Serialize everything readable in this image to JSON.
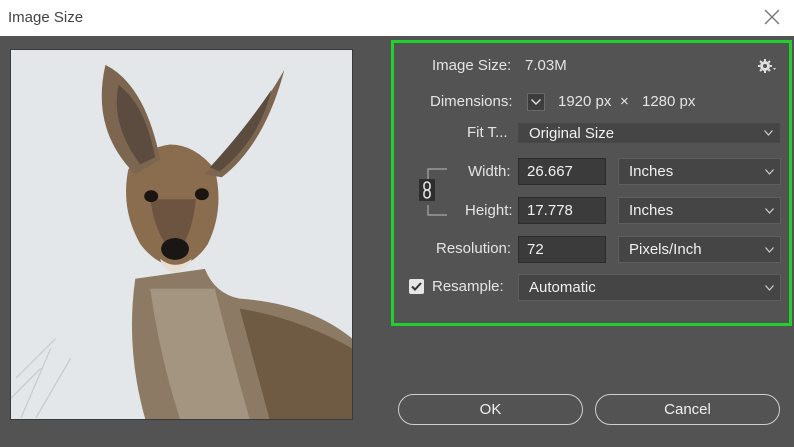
{
  "window": {
    "title": "Image Size"
  },
  "info": {
    "image_size_label": "Image Size:",
    "image_size_value": "7.03M",
    "dimensions_label": "Dimensions:",
    "dim_width": "1920 px",
    "dim_times": "×",
    "dim_height": "1280 px"
  },
  "fit_to": {
    "label": "Fit T...",
    "value": "Original Size"
  },
  "width": {
    "label": "Width:",
    "value": "26.667",
    "unit": "Inches"
  },
  "height": {
    "label": "Height:",
    "value": "17.778",
    "unit": "Inches"
  },
  "resolution": {
    "label": "Resolution:",
    "value": "72",
    "unit": "Pixels/Inch"
  },
  "resample": {
    "label": "Resample:",
    "value": "Automatic",
    "checked": true
  },
  "buttons": {
    "ok": "OK",
    "cancel": "Cancel"
  },
  "colors": {
    "highlight": "#21d12b",
    "background": "#535353"
  }
}
